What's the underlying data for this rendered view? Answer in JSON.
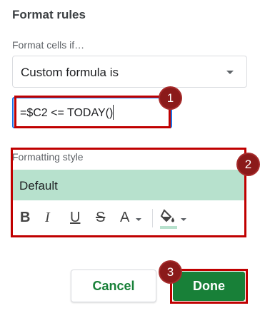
{
  "title": "Format rules",
  "condition": {
    "label": "Format cells if…",
    "selected": "Custom formula is",
    "formula": "=$C2 <= TODAY()"
  },
  "style": {
    "label": "Formatting style",
    "preview_text": "Default",
    "preview_color": "#b7e1cd",
    "tools": {
      "bold": "B",
      "italic": "I",
      "underline": "U",
      "strike": "S",
      "text_color": "A"
    }
  },
  "buttons": {
    "cancel": "Cancel",
    "done": "Done"
  },
  "badges": [
    "1",
    "2",
    "3"
  ],
  "colors": {
    "highlight": "#c00000",
    "badge": "#8b1a1a",
    "accent_green": "#188038"
  }
}
